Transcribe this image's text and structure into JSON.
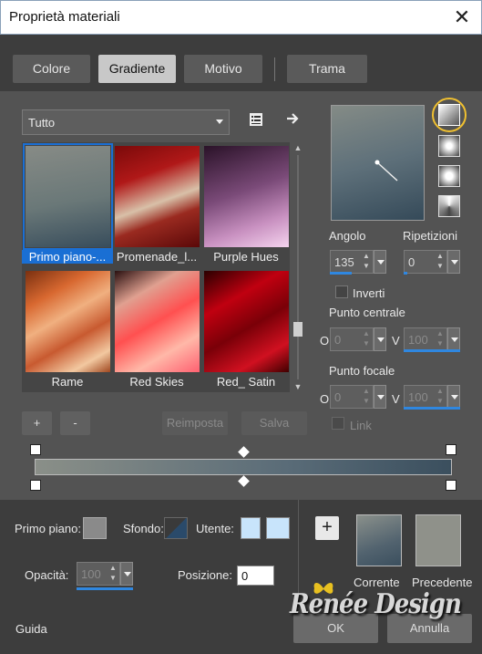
{
  "window": {
    "title": "Proprietà materiali"
  },
  "tabs": [
    {
      "label": "Colore"
    },
    {
      "label": "Gradiente"
    },
    {
      "label": "Motivo"
    },
    {
      "label": "Trama"
    }
  ],
  "library": {
    "category": "Tutto",
    "items": [
      {
        "label": "Primo piano-...",
        "colors": [
          "#878b86",
          "#384d5c"
        ]
      },
      {
        "label": "Promenade_l...",
        "colors": [
          "#8a1010",
          "#d0b8a0",
          "#6a0e0e"
        ]
      },
      {
        "label": "Purple Hues",
        "colors": [
          "#3a1b3a",
          "#8a5a8a",
          "#f0c8e8"
        ]
      },
      {
        "label": "Rame",
        "colors": [
          "#8a3b10",
          "#e8a070",
          "#f0c8a0"
        ]
      },
      {
        "label": "Red Skies",
        "colors": [
          "#2a1010",
          "#ff6060",
          "#ffb0a0"
        ]
      },
      {
        "label": "Red_ Satin",
        "colors": [
          "#3a0000",
          "#c00010",
          "#600000"
        ]
      }
    ]
  },
  "controls": {
    "add_label": "+",
    "remove_label": "-",
    "reset_label": "Reimposta",
    "save_label": "Salva"
  },
  "settings": {
    "angle_label": "Angolo",
    "angle_value": "135",
    "repeats_label": "Ripetizioni",
    "repeats_value": "0",
    "invert_label": "Inverti",
    "center_label": "Punto centrale",
    "center_o_label": "O",
    "center_o_value": "0",
    "center_v_label": "V",
    "center_v_value": "100",
    "focal_label": "Punto focale",
    "focal_o_label": "O",
    "focal_o_value": "0",
    "focal_v_label": "V",
    "focal_v_value": "100",
    "link_label": "Link"
  },
  "bottom": {
    "foreground_label": "Primo piano:",
    "background_label": "Sfondo:",
    "user_label": "Utente:",
    "opacity_label": "Opacità:",
    "opacity_value": "100",
    "position_label": "Posizione:",
    "position_value": "0",
    "current_label": "Corrente",
    "previous_label": "Precedente",
    "help_label": "Guida",
    "ok_label": "OK",
    "cancel_label": "Annulla",
    "add_swatch_label": "+"
  },
  "watermark": {
    "text": "Renée Design"
  },
  "colors": {
    "accent": "#1a6fd4",
    "gradient_start": "#8a8f88",
    "gradient_end": "#3b4f5e",
    "current_swatch": "#52636f",
    "previous_swatch": "#8f918a",
    "user_swatch": "#c8e4fb"
  }
}
